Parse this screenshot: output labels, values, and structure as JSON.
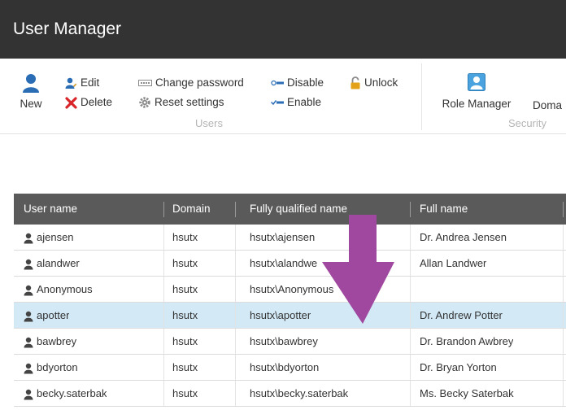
{
  "app": {
    "title": "User Manager"
  },
  "ribbon": {
    "new_label": "New",
    "edit_label": "Edit",
    "delete_label": "Delete",
    "change_password_label": "Change password",
    "reset_settings_label": "Reset settings",
    "disable_label": "Disable",
    "enable_label": "Enable",
    "unlock_label": "Unlock",
    "users_group_label": "Users",
    "role_manager_label": "Role Manager",
    "domain_label": "Doma",
    "security_group_label": "Security"
  },
  "grid": {
    "columns": [
      "User name",
      "Domain",
      "Fully qualified name",
      "Full name"
    ],
    "rows": [
      {
        "user": "ajensen",
        "domain": "hsutx",
        "fqn": "hsutx\\ajensen",
        "full": "Dr. Andrea Jensen"
      },
      {
        "user": "alandwer",
        "domain": "hsutx",
        "fqn": "hsutx\\alandwe",
        "full": "Allan Landwer"
      },
      {
        "user": "Anonymous",
        "domain": "hsutx",
        "fqn": "hsutx\\Anonymous",
        "full": ""
      },
      {
        "user": "apotter",
        "domain": "hsutx",
        "fqn": "hsutx\\apotter",
        "full": "Dr. Andrew Potter",
        "selected": true
      },
      {
        "user": "bawbrey",
        "domain": "hsutx",
        "fqn": "hsutx\\bawbrey",
        "full": "Dr. Brandon Awbrey"
      },
      {
        "user": "bdyorton",
        "domain": "hsutx",
        "fqn": "hsutx\\bdyorton",
        "full": "Dr. Bryan Yorton"
      },
      {
        "user": "becky.saterbak",
        "domain": "hsutx",
        "fqn": "hsutx\\becky.saterbak",
        "full": "Ms. Becky Saterbak"
      }
    ]
  },
  "colors": {
    "titlebar": "#333333",
    "header": "#5a5a5a",
    "selected_row": "#d3e9f6",
    "arrow": "#a0479f"
  }
}
